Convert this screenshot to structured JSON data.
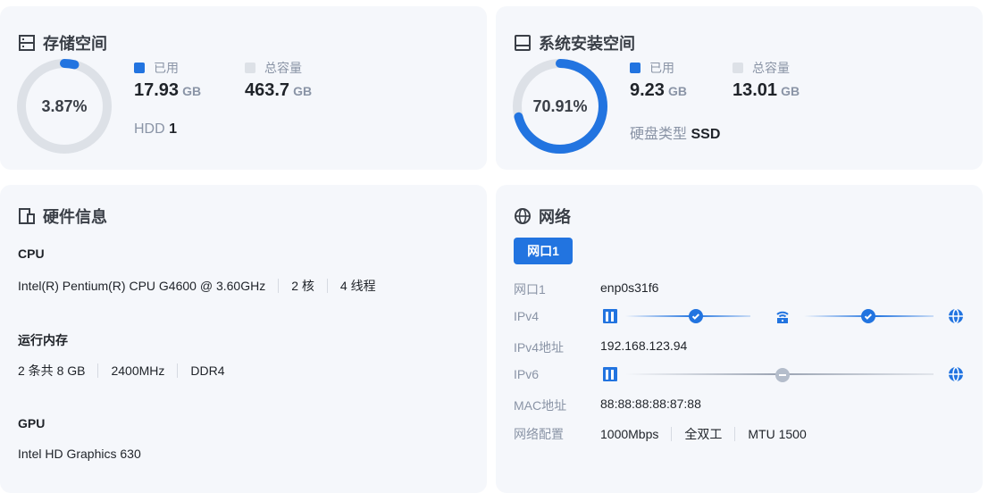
{
  "storage": {
    "title": "存储空间",
    "percent": "3.87%",
    "percent_value": 3.87,
    "used_label": "已用",
    "used_value": "17.93",
    "used_unit": "GB",
    "total_label": "总容量",
    "total_value": "463.7",
    "total_unit": "GB",
    "disk_label": "HDD",
    "disk_count": "1"
  },
  "system": {
    "title": "系统安装空间",
    "percent": "70.91%",
    "percent_value": 70.91,
    "used_label": "已用",
    "used_value": "9.23",
    "used_unit": "GB",
    "total_label": "总容量",
    "total_value": "13.01",
    "total_unit": "GB",
    "disk_type_label": "硬盘类型",
    "disk_type": "SSD"
  },
  "hardware": {
    "title": "硬件信息",
    "cpu_label": "CPU",
    "cpu_model": "Intel(R) Pentium(R) CPU G4600 @ 3.60GHz",
    "cpu_cores": "2 核",
    "cpu_threads": "4 线程",
    "mem_label": "运行内存",
    "mem_size": "2 条共 8 GB",
    "mem_freq": "2400MHz",
    "mem_type": "DDR4",
    "gpu_label": "GPU",
    "gpu_model": "Intel HD Graphics 630"
  },
  "network": {
    "title": "网络",
    "tab": "网口1",
    "port_label": "网口1",
    "port_value": "enp0s31f6",
    "ipv4_label": "IPv4",
    "ipv4_addr_label": "IPv4地址",
    "ipv4_addr": "192.168.123.94",
    "ipv6_label": "IPv6",
    "mac_label": "MAC地址",
    "mac": "88:88:88:88:87:88",
    "config_label": "网络配置",
    "speed": "1000Mbps",
    "duplex": "全双工",
    "mtu": "MTU 1500"
  },
  "colors": {
    "accent": "#2274e0",
    "track": "#dde1e7"
  }
}
